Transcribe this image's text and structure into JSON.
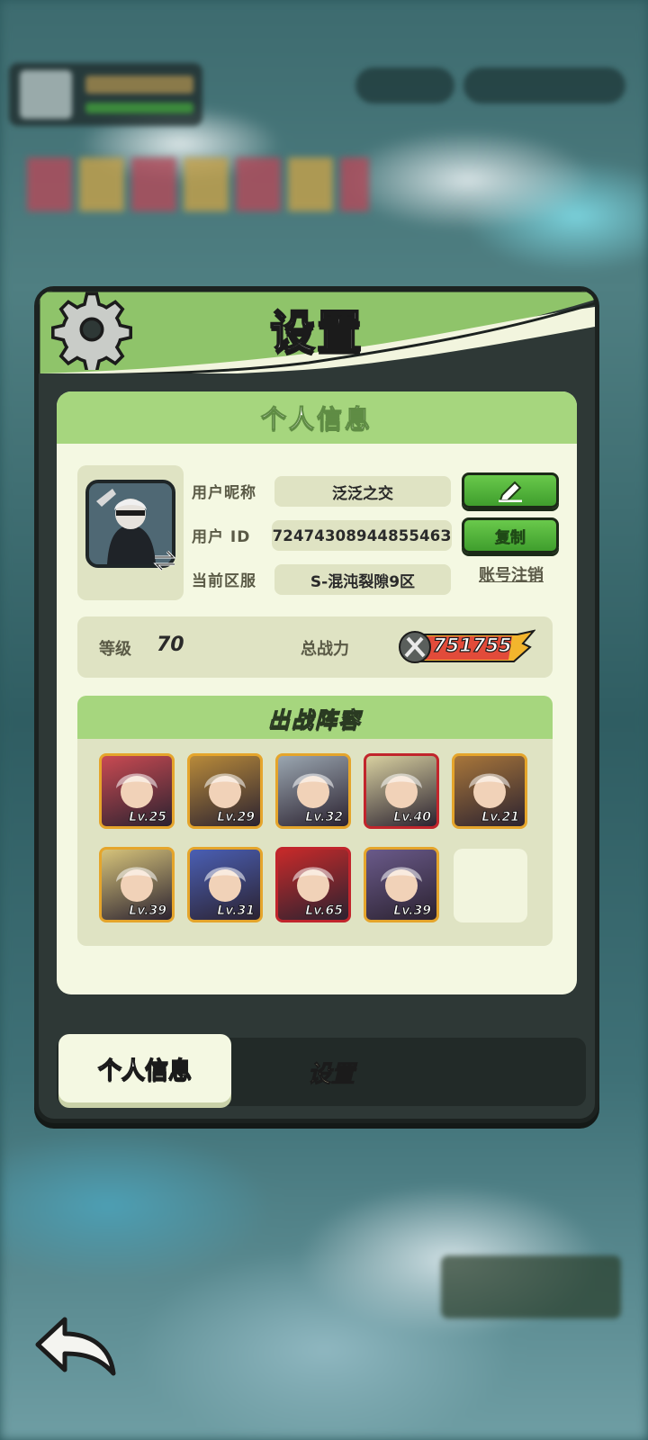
{
  "panel": {
    "title": "设置"
  },
  "personal_info": {
    "header": "个人信息",
    "nickname_label": "用户昵称",
    "nickname": "泛泛之交",
    "id_label": "用户  ID",
    "user_id": "7247430894485546З",
    "server_label": "当前区服",
    "server": "S-混沌裂隙9区",
    "copy_button": "复制",
    "logout_link": "账号注销",
    "edit_icon": "edit-pen-icon"
  },
  "stats": {
    "level_label": "等级",
    "level": "70",
    "power_label": "总战力",
    "power": "751755"
  },
  "team": {
    "header": "出战阵容",
    "heroes": [
      {
        "level": "Lv.25",
        "frame": "gold",
        "color": "#c94a52"
      },
      {
        "level": "Lv.29",
        "frame": "gold",
        "color": "#b88a3a"
      },
      {
        "level": "Lv.32",
        "frame": "gold",
        "color": "#9aa6b0"
      },
      {
        "level": "Lv.40",
        "frame": "red",
        "color": "#d8d0a0"
      },
      {
        "level": "Lv.21",
        "frame": "gold",
        "color": "#a8763a"
      },
      {
        "level": "Lv.39",
        "frame": "gold",
        "color": "#d6c37a"
      },
      {
        "level": "Lv.31",
        "frame": "gold",
        "color": "#4a5fb4"
      },
      {
        "level": "Lv.65",
        "frame": "red",
        "color": "#c72a2a"
      },
      {
        "level": "Lv.39",
        "frame": "gold",
        "color": "#6a5a8a"
      }
    ]
  },
  "tabs": {
    "active": "个人信息",
    "inactive": "设置"
  },
  "colors": {
    "accent_green": "#a6d67e",
    "button_green": "#4fb23a",
    "sheet_bg": "#f4f8e2",
    "panel_dark": "#2e3836"
  }
}
